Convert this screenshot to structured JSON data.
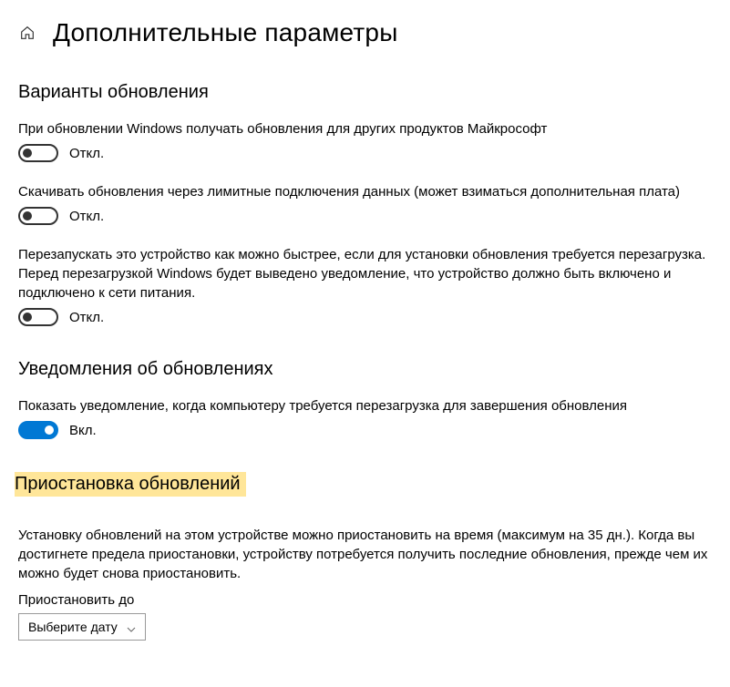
{
  "header": {
    "title": "Дополнительные параметры"
  },
  "sections": {
    "update_options": {
      "title": "Варианты обновления",
      "opt1": {
        "desc": "При обновлении Windows получать обновления для других продуктов Майкрософт",
        "state": "Откл."
      },
      "opt2": {
        "desc": "Скачивать обновления через лимитные подключения данных (может взиматься дополнительная плата)",
        "state": "Откл."
      },
      "opt3": {
        "desc": "Перезапускать это устройство как можно быстрее, если для установки обновления требуется перезагрузка. Перед перезагрузкой Windows будет выведено уведомление, что устройство должно быть включено и подключено к сети питания.",
        "state": "Откл."
      }
    },
    "notifications": {
      "title": "Уведомления об обновлениях",
      "opt1": {
        "desc": "Показать уведомление, когда компьютеру требуется перезагрузка для завершения обновления",
        "state": "Вкл."
      }
    },
    "pause": {
      "title": "Приостановка обновлений",
      "desc": "Установку обновлений на этом устройстве можно приостановить на время (максимум на 35 дн.). Когда вы достигнете предела приостановки, устройству потребуется получить последние обновления, прежде чем их можно будет снова приостановить.",
      "until_label": "Приостановить до",
      "select_placeholder": "Выберите дату"
    }
  }
}
